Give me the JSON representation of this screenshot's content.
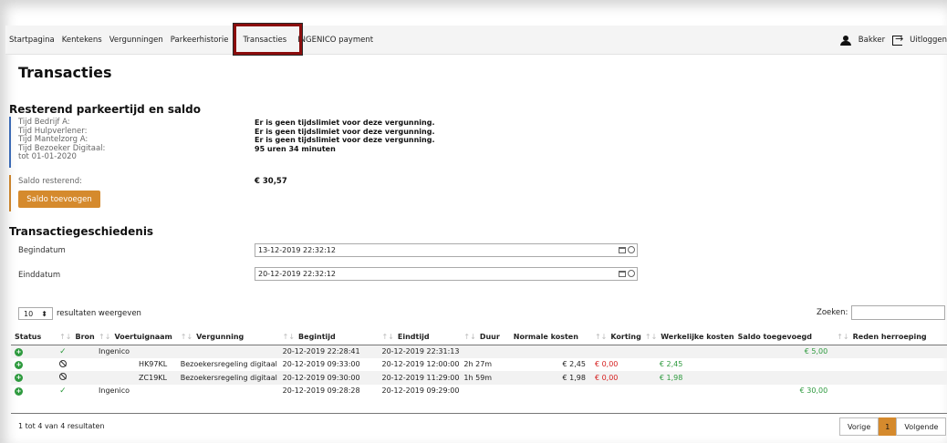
{
  "nav": {
    "items": [
      "Startpagina",
      "Kentekens",
      "Vergunningen",
      "Parkeerhistorie",
      "Transacties",
      "INGENICO payment"
    ],
    "user": "Bakker",
    "logout": "Uitloggen"
  },
  "page_title": "Transacties",
  "balance_section": {
    "title": "Resterend parkeertijd en saldo",
    "rows": [
      {
        "label": "Tijd Bedrijf A:",
        "value": "Er is geen tijdslimiet voor deze vergunning."
      },
      {
        "label": "Tijd Hulpverlener:",
        "value": "Er is geen tijdslimiet voor deze vergunning."
      },
      {
        "label": "Tijd Mantelzorg A:",
        "value": "Er is geen tijdslimiet voor deze vergunning."
      },
      {
        "label": "Tijd Bezoeker Digitaal:",
        "value": "95 uren 34 minuten"
      },
      {
        "label": "tot 01-01-2020",
        "value": ""
      }
    ],
    "saldo_label": "Saldo resterend:",
    "saldo_value": "€ 30,57",
    "add_button": "Saldo toevoegen"
  },
  "history": {
    "title": "Transactiegeschiedenis",
    "begin_label": "Begindatum",
    "begin_value": "13-12-2019 22:32:12",
    "end_label": "Einddatum",
    "end_value": "20-12-2019 22:32:12",
    "page_length": "10",
    "page_length_suffix": "resultaten weergeven",
    "search_label": "Zoeken:",
    "columns": [
      "Status",
      "Bron",
      "Voertuignaam",
      "Vergunning",
      "Begintijd",
      "Eindtijd",
      "Duur",
      "Normale kosten",
      "Korting",
      "Werkelijke kosten",
      "Saldo toegevoegd",
      "Reden herroeping"
    ],
    "rows": [
      {
        "status": "check",
        "bron": "Ingenico",
        "voertuig": "",
        "vergunning": "",
        "begin": "20-12-2019 22:28:41",
        "eind": "20-12-2019 22:31:13",
        "duur": "",
        "normaal": "",
        "korting": "",
        "werkelijk": "",
        "saldo": "€ 5,00",
        "reden": ""
      },
      {
        "status": "ban",
        "bron": "",
        "voertuig": "HK97KL",
        "vergunning": "Bezoekersregeling digitaal",
        "begin": "20-12-2019 09:33:00",
        "eind": "20-12-2019 12:00:00",
        "duur": "2h 27m",
        "normaal": "€ 2,45",
        "korting": "€ 0,00",
        "werkelijk": "€ 2,45",
        "saldo": "",
        "reden": ""
      },
      {
        "status": "ban",
        "bron": "",
        "voertuig": "ZC19KL",
        "vergunning": "Bezoekersregeling digitaal",
        "begin": "20-12-2019 09:30:00",
        "eind": "20-12-2019 11:29:00",
        "duur": "1h 59m",
        "normaal": "€ 1,98",
        "korting": "€ 0,00",
        "werkelijk": "€ 1,98",
        "saldo": "",
        "reden": ""
      },
      {
        "status": "check",
        "bron": "Ingenico",
        "voertuig": "",
        "vergunning": "",
        "begin": "20-12-2019 09:28:28",
        "eind": "20-12-2019 09:29:00",
        "duur": "",
        "normaal": "",
        "korting": "",
        "werkelijk": "",
        "saldo": "€ 30,00",
        "reden": ""
      }
    ],
    "info": "1 tot 4 van 4 resultaten",
    "prev": "Vorige",
    "page": "1",
    "next": "Volgende"
  },
  "colors": {
    "accent": "#d58a2d",
    "positive": "#2e9a3e",
    "negative": "#d62020",
    "highlight_box": "#8b0d0d"
  }
}
